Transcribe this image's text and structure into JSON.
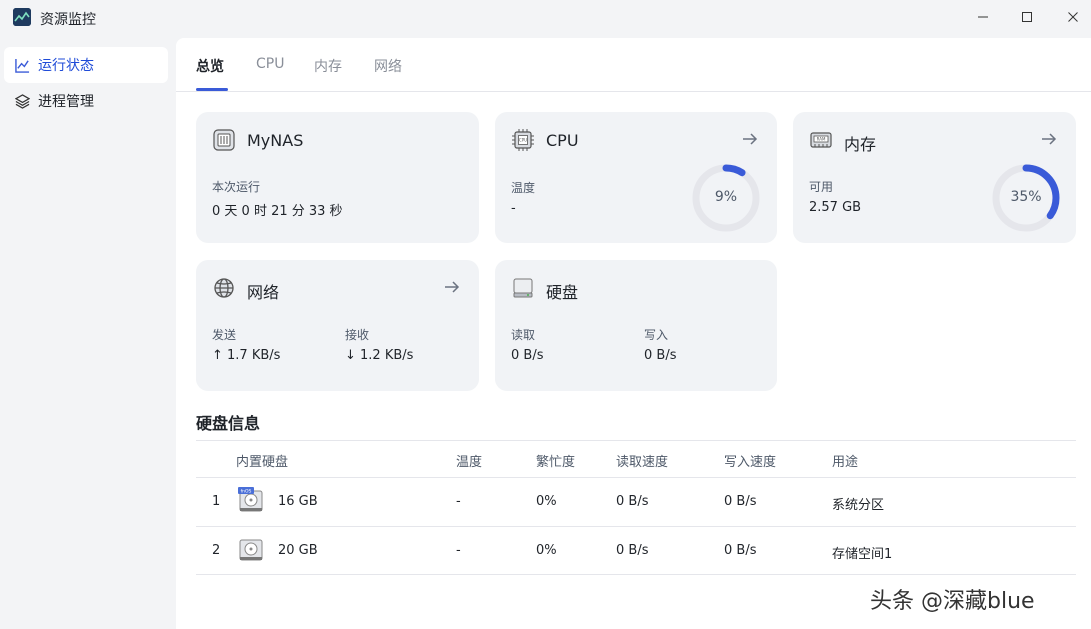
{
  "window": {
    "title": "资源监控",
    "minimize_glyph": "—",
    "maximize_glyph": "☐",
    "close_glyph": "✕"
  },
  "sidebar": {
    "items": [
      {
        "label": "运行状态",
        "icon": "line-chart-icon",
        "active": true
      },
      {
        "label": "进程管理",
        "icon": "layers-icon",
        "active": false
      }
    ]
  },
  "tabs": [
    {
      "label": "总览",
      "active": true
    },
    {
      "label": "CPU",
      "active": false
    },
    {
      "label": "内存",
      "active": false
    },
    {
      "label": "网络",
      "active": false
    }
  ],
  "cards": {
    "system": {
      "title": "MyNAS",
      "uptime_label": "本次运行",
      "uptime_value": "0 天 0 时 21 分 33 秒"
    },
    "cpu": {
      "title": "CPU",
      "temp_label": "温度",
      "temp_value": "-",
      "usage_text": "9%",
      "usage_fraction": 0.09
    },
    "memory": {
      "title": "内存",
      "available_label": "可用",
      "available_value": "2.57 GB",
      "usage_text": "35%",
      "usage_fraction": 0.35
    },
    "network": {
      "title": "网络",
      "send_label": "发送",
      "send_value": "↑ 1.7 KB/s",
      "recv_label": "接收",
      "recv_value": "↓ 1.2 KB/s"
    },
    "disk": {
      "title": "硬盘",
      "read_label": "读取",
      "read_value": "0 B/s",
      "write_label": "写入",
      "write_value": "0 B/s"
    }
  },
  "disk_info": {
    "title": "硬盘信息",
    "headers": {
      "disk": "内置硬盘",
      "temp": "温度",
      "busy": "繁忙度",
      "read": "读取速度",
      "write": "写入速度",
      "usage": "用途"
    },
    "rows": [
      {
        "index": "1",
        "size": "16 GB",
        "temp": "-",
        "busy": "0%",
        "read": "0 B/s",
        "write": "0 B/s",
        "usage": "系统分区",
        "badge": "fnOS"
      },
      {
        "index": "2",
        "size": "20 GB",
        "temp": "-",
        "busy": "0%",
        "read": "0 B/s",
        "write": "0 B/s",
        "usage": "存储空间1",
        "badge": ""
      }
    ]
  },
  "watermark": "头条 @深藏blue",
  "colors": {
    "accent": "#3a5bd8",
    "card_bg": "#f1f3f6",
    "gauge_track": "#e5e6eb"
  }
}
